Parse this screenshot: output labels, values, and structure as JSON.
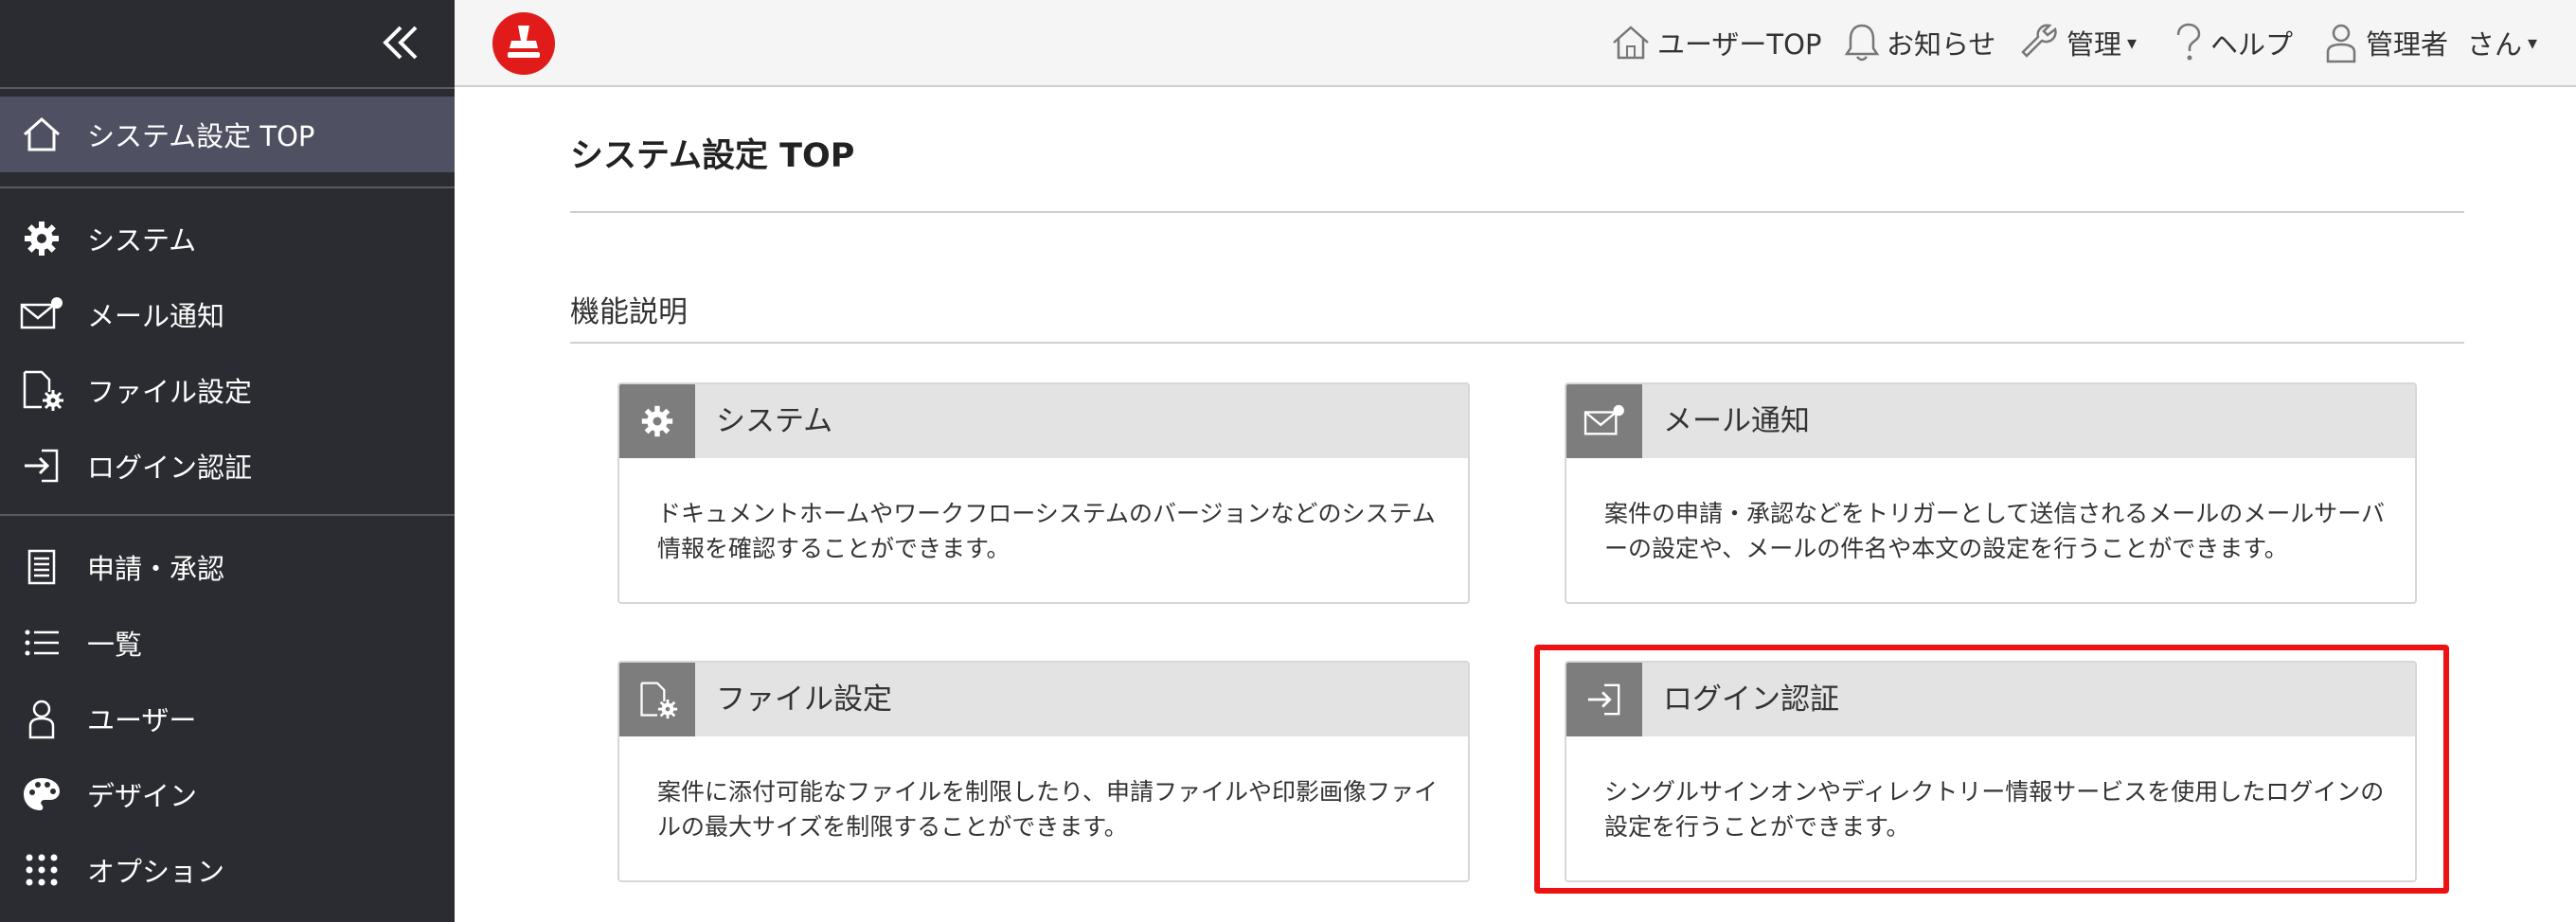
{
  "sidebar": {
    "items": [
      {
        "label": "システム設定 TOP",
        "icon": "home-icon"
      },
      {
        "label": "システム",
        "icon": "gear-icon"
      },
      {
        "label": "メール通知",
        "icon": "mail-notify-icon"
      },
      {
        "label": "ファイル設定",
        "icon": "file-settings-icon"
      },
      {
        "label": "ログイン認証",
        "icon": "login-icon"
      },
      {
        "label": "申請・承認",
        "icon": "document-icon"
      },
      {
        "label": "一覧",
        "icon": "list-icon"
      },
      {
        "label": "ユーザー",
        "icon": "user-icon"
      },
      {
        "label": "デザイン",
        "icon": "palette-icon"
      },
      {
        "label": "オプション",
        "icon": "grid-icon"
      }
    ],
    "active_item": "システム設定 TOP"
  },
  "topbar": {
    "user_top": "ユーザーTOP",
    "notices": "お知らせ",
    "admin": "管理",
    "help": "ヘルプ",
    "user_name": "管理者",
    "user_suffix": "さん",
    "caret": "▾"
  },
  "main": {
    "page_title": "システム設定 TOP",
    "section_title": "機能説明",
    "cards": [
      {
        "title": "システム",
        "icon": "gear-icon",
        "desc": "ドキュメントホームやワークフローシステムのバージョンなどのシステム情報を確認することができます。"
      },
      {
        "title": "メール通知",
        "icon": "mail-notify-icon",
        "desc": "案件の申請・承認などをトリガーとして送信されるメールのメールサーバーの設定や、メールの件名や本文の設定を行うことができます。"
      },
      {
        "title": "ファイル設定",
        "icon": "file-settings-icon",
        "desc": "案件に添付可能なファイルを制限したり、申請ファイルや印影画像ファイルの最大サイズを制限することができます。"
      },
      {
        "title": "ログイン認証",
        "icon": "login-icon",
        "desc": "シングルサインオンやディレクトリー情報サービスを使用したログインの設定を行うことができます。"
      }
    ]
  },
  "colors": {
    "sidebar_bg": "#2b2c31",
    "sidebar_active": "#4f5061",
    "highlight": "#ee1111",
    "logo_red": "#e11a1a"
  }
}
